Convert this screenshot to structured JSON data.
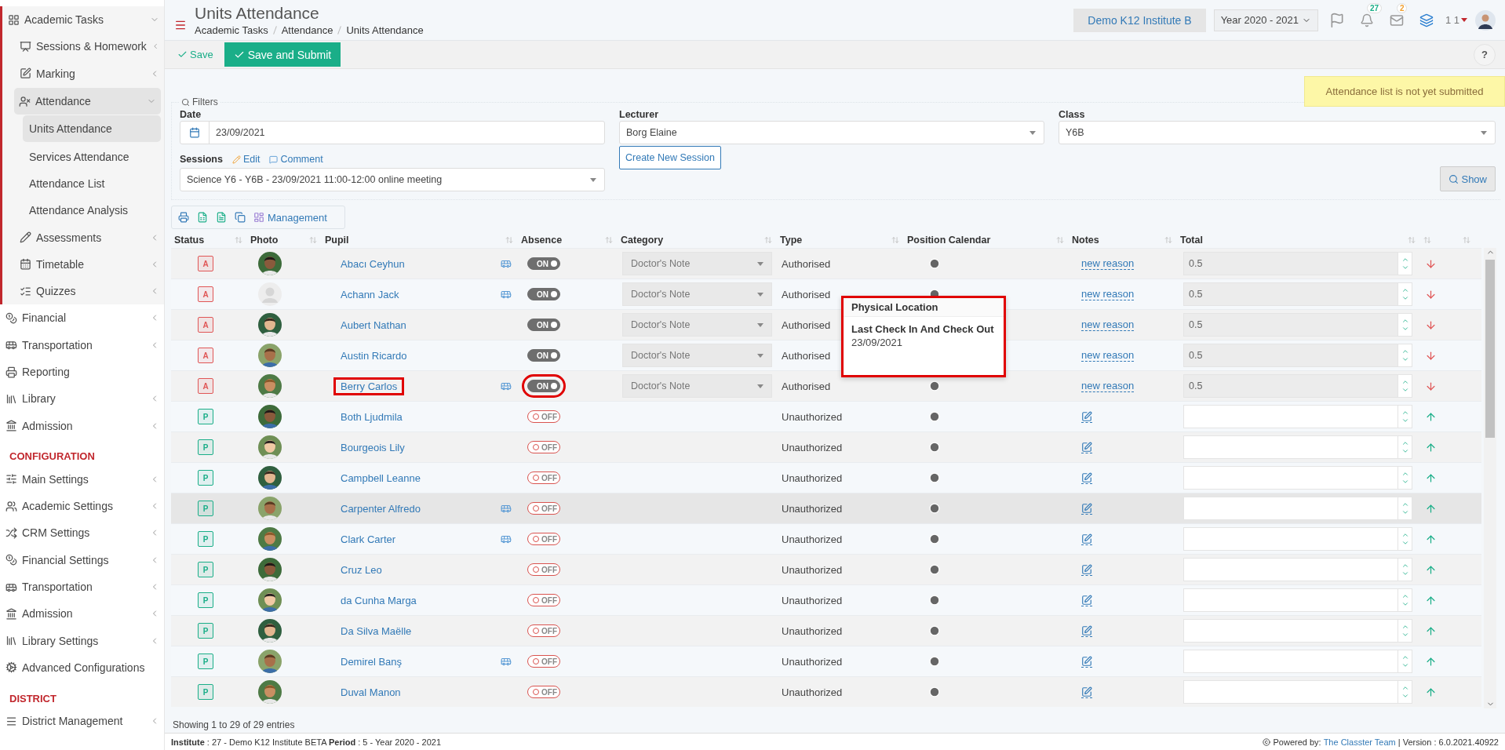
{
  "sidebar": [
    {
      "kind": "item",
      "label": "Academic Tasks",
      "expandable": true,
      "expanded": true,
      "selected": false,
      "children": [
        {
          "kind": "item",
          "label": "Sessions & Homework",
          "expandable": true,
          "expanded": false,
          "selected": false
        },
        {
          "kind": "item",
          "label": "Marking",
          "expandable": true,
          "expanded": false,
          "selected": false
        },
        {
          "kind": "item",
          "label": "Attendance",
          "expandable": true,
          "expanded": true,
          "selected": true,
          "children": [
            {
              "kind": "item",
              "label": "Units Attendance",
              "expandable": false,
              "expanded": false,
              "selected": true
            },
            {
              "kind": "item",
              "label": "Services Attendance",
              "expandable": false,
              "expanded": false,
              "selected": false
            },
            {
              "kind": "item",
              "label": "Attendance List",
              "expandable": false,
              "expanded": false,
              "selected": false
            },
            {
              "kind": "item",
              "label": "Attendance Analysis",
              "expandable": false,
              "expanded": false,
              "selected": false
            }
          ]
        },
        {
          "kind": "item",
          "label": "Assessments",
          "expandable": true,
          "expanded": false,
          "selected": false
        },
        {
          "kind": "item",
          "label": "Timetable",
          "expandable": true,
          "expanded": false,
          "selected": false
        },
        {
          "kind": "item",
          "label": "Quizzes",
          "expandable": true,
          "expanded": false,
          "selected": false
        }
      ]
    },
    {
      "kind": "item",
      "label": "Financial",
      "expandable": true,
      "expanded": false,
      "selected": false
    },
    {
      "kind": "item",
      "label": "Transportation",
      "expandable": true,
      "expanded": false,
      "selected": false
    },
    {
      "kind": "item",
      "label": "Reporting",
      "expandable": false,
      "expanded": false,
      "selected": false
    },
    {
      "kind": "item",
      "label": "Library",
      "expandable": true,
      "expanded": false,
      "selected": false
    },
    {
      "kind": "item",
      "label": "Admission",
      "expandable": true,
      "expanded": false,
      "selected": false
    },
    {
      "kind": "heading",
      "label": "CONFIGURATION"
    },
    {
      "kind": "item",
      "label": "Main Settings",
      "expandable": true,
      "expanded": false,
      "selected": false
    },
    {
      "kind": "item",
      "label": "Academic Settings",
      "expandable": true,
      "expanded": false,
      "selected": false
    },
    {
      "kind": "item",
      "label": "CRM Settings",
      "expandable": true,
      "expanded": false,
      "selected": false
    },
    {
      "kind": "item",
      "label": "Financial Settings",
      "expandable": true,
      "expanded": false,
      "selected": false
    },
    {
      "kind": "item",
      "label": "Transportation",
      "expandable": true,
      "expanded": false,
      "selected": false
    },
    {
      "kind": "item",
      "label": "Admission",
      "expandable": true,
      "expanded": false,
      "selected": false
    },
    {
      "kind": "item",
      "label": "Library Settings",
      "expandable": true,
      "expanded": false,
      "selected": false
    },
    {
      "kind": "item",
      "label": "Advanced Configurations",
      "expandable": false,
      "expanded": false,
      "selected": false
    },
    {
      "kind": "heading",
      "label": "DISTRICT"
    },
    {
      "kind": "item",
      "label": "District Management",
      "expandable": true,
      "expanded": false,
      "selected": false
    }
  ],
  "header": {
    "title": "Units Attendance",
    "breadcrumbs": [
      "Academic Tasks",
      "Attendance",
      "Units Attendance"
    ],
    "institute": "Demo K12 Institute B",
    "year": "Year 2020 - 2021",
    "notifications": "27",
    "messages": "2",
    "user": "1 1"
  },
  "toolbar": {
    "save": "Save",
    "save_submit": "Save and Submit",
    "help": "?"
  },
  "alert": "Attendance list is not yet submitted",
  "filters": {
    "legend": "Filters",
    "date_label": "Date",
    "date": "23/09/2021",
    "lecturer_label": "Lecturer",
    "lecturer": "Borg Elaine",
    "class_label": "Class",
    "class": "Y6B",
    "sessions_label": "Sessions",
    "edit": "Edit",
    "comment": "Comment",
    "session": "Science Y6 - Y6B - 23/09/2021 11:00-12:00 online meeting",
    "create": "Create New Session",
    "show": "Show"
  },
  "table_tools": {
    "management": "Management"
  },
  "columns": [
    "Status",
    "Photo",
    "Pupil",
    "Absence",
    "Category",
    "Type",
    "Position Calendar",
    "Notes",
    "Total"
  ],
  "rows": [
    {
      "status": {
        "label": "A",
        "color": "#e05656"
      },
      "pupil": "Abacı Ceyhun",
      "bus": true,
      "highlighted": false,
      "hovered": false,
      "absence": {
        "on": true,
        "label": "ON"
      },
      "category": "Doctor's Note",
      "type": "Authorised",
      "notes": {
        "kind": "link",
        "text": "new reason"
      },
      "total": "0.5"
    },
    {
      "status": {
        "label": "A",
        "color": "#e05656"
      },
      "photo": {
        "kind": "placeholder"
      },
      "pupil": "Achann Jack",
      "bus": true,
      "highlighted": false,
      "hovered": false,
      "absence": {
        "on": true,
        "label": "ON"
      },
      "category": "Doctor's Note",
      "type": "Authorised",
      "notes": {
        "kind": "link",
        "text": "new reason"
      },
      "total": "0.5"
    },
    {
      "status": {
        "label": "A",
        "color": "#e05656"
      },
      "pupil": "Aubert Nathan",
      "clock_covered": true,
      "bus": false,
      "highlighted": false,
      "hovered": false,
      "absence": {
        "on": true,
        "label": "ON"
      },
      "category": "Doctor's Note",
      "type": "Authorised",
      "notes": {
        "kind": "link",
        "text": "new reason"
      },
      "total": "0.5"
    },
    {
      "status": {
        "label": "A",
        "color": "#e05656"
      },
      "pupil": "Austin Ricardo",
      "clock_covered": true,
      "bus": false,
      "highlighted": false,
      "hovered": false,
      "absence": {
        "on": true,
        "label": "ON"
      },
      "category": "Doctor's Note",
      "type": "Authorised",
      "notes": {
        "kind": "link",
        "text": "new reason"
      },
      "total": "0.5"
    },
    {
      "status": {
        "label": "A",
        "color": "#e05656"
      },
      "pupil": "Berry Carlos",
      "bus": true,
      "highlighted": true,
      "hovered": false,
      "absence": {
        "on": true,
        "label": "ON"
      },
      "category": "Doctor's Note",
      "type": "Authorised",
      "notes": {
        "kind": "link",
        "text": "new reason"
      },
      "total": "0.5"
    },
    {
      "status": {
        "label": "P",
        "color": "#1aae88"
      },
      "pupil": "Both Ljudmila",
      "bus": false,
      "highlighted": false,
      "hovered": false,
      "absence": {
        "on": false,
        "label": "OFF"
      },
      "type": "Unauthorized",
      "notes": {
        "kind": "edit"
      }
    },
    {
      "status": {
        "label": "P",
        "color": "#1aae88"
      },
      "pupil": "Bourgeois Lily",
      "bus": false,
      "highlighted": false,
      "hovered": false,
      "absence": {
        "on": false,
        "label": "OFF"
      },
      "type": "Unauthorized",
      "notes": {
        "kind": "edit"
      }
    },
    {
      "status": {
        "label": "P",
        "color": "#1aae88"
      },
      "pupil": "Campbell Leanne",
      "bus": false,
      "highlighted": false,
      "hovered": false,
      "absence": {
        "on": false,
        "label": "OFF"
      },
      "type": "Unauthorized",
      "notes": {
        "kind": "edit"
      }
    },
    {
      "status": {
        "label": "P",
        "color": "#1aae88"
      },
      "pupil": "Carpenter Alfredo",
      "bus": true,
      "highlighted": false,
      "hovered": true,
      "absence": {
        "on": false,
        "label": "OFF"
      },
      "type": "Unauthorized",
      "notes": {
        "kind": "edit"
      }
    },
    {
      "status": {
        "label": "P",
        "color": "#1aae88"
      },
      "pupil": "Clark Carter",
      "bus": true,
      "highlighted": false,
      "hovered": false,
      "absence": {
        "on": false,
        "label": "OFF"
      },
      "type": "Unauthorized",
      "notes": {
        "kind": "edit"
      }
    },
    {
      "status": {
        "label": "P",
        "color": "#1aae88"
      },
      "pupil": "Cruz Leo",
      "bus": false,
      "highlighted": false,
      "hovered": false,
      "absence": {
        "on": false,
        "label": "OFF"
      },
      "type": "Unauthorized",
      "notes": {
        "kind": "edit"
      }
    },
    {
      "status": {
        "label": "P",
        "color": "#1aae88"
      },
      "pupil": "da Cunha Marga",
      "bus": false,
      "highlighted": false,
      "hovered": false,
      "absence": {
        "on": false,
        "label": "OFF"
      },
      "type": "Unauthorized",
      "notes": {
        "kind": "edit"
      }
    },
    {
      "status": {
        "label": "P",
        "color": "#1aae88"
      },
      "pupil": "Da Silva Maëlle",
      "bus": false,
      "highlighted": false,
      "hovered": false,
      "absence": {
        "on": false,
        "label": "OFF"
      },
      "type": "Unauthorized",
      "notes": {
        "kind": "edit"
      }
    },
    {
      "status": {
        "label": "P",
        "color": "#1aae88"
      },
      "pupil": "Demirel Banş",
      "bus": true,
      "highlighted": false,
      "hovered": false,
      "absence": {
        "on": false,
        "label": "OFF"
      },
      "type": "Unauthorized",
      "notes": {
        "kind": "edit"
      }
    },
    {
      "status": {
        "label": "P",
        "color": "#1aae88"
      },
      "pupil": "Duval Manon",
      "bus": false,
      "highlighted": false,
      "hovered": false,
      "absence": {
        "on": false,
        "label": "OFF"
      },
      "type": "Unauthorized",
      "notes": {
        "kind": "edit"
      }
    }
  ],
  "tooltip": {
    "title": "Physical Location",
    "heading": "Last Check In And Check Out",
    "date": "23/09/2021"
  },
  "showing": "Showing 1 to 29 of 29 entries",
  "footer": {
    "info": "**Institute** : 27 - Demo K12 Institute BETA **Period** : 5 - Year 2020 - 2021",
    "powered": "Powered by:",
    "team": "The Classter Team",
    "version": "| Version : 6.0.2021.40922"
  }
}
